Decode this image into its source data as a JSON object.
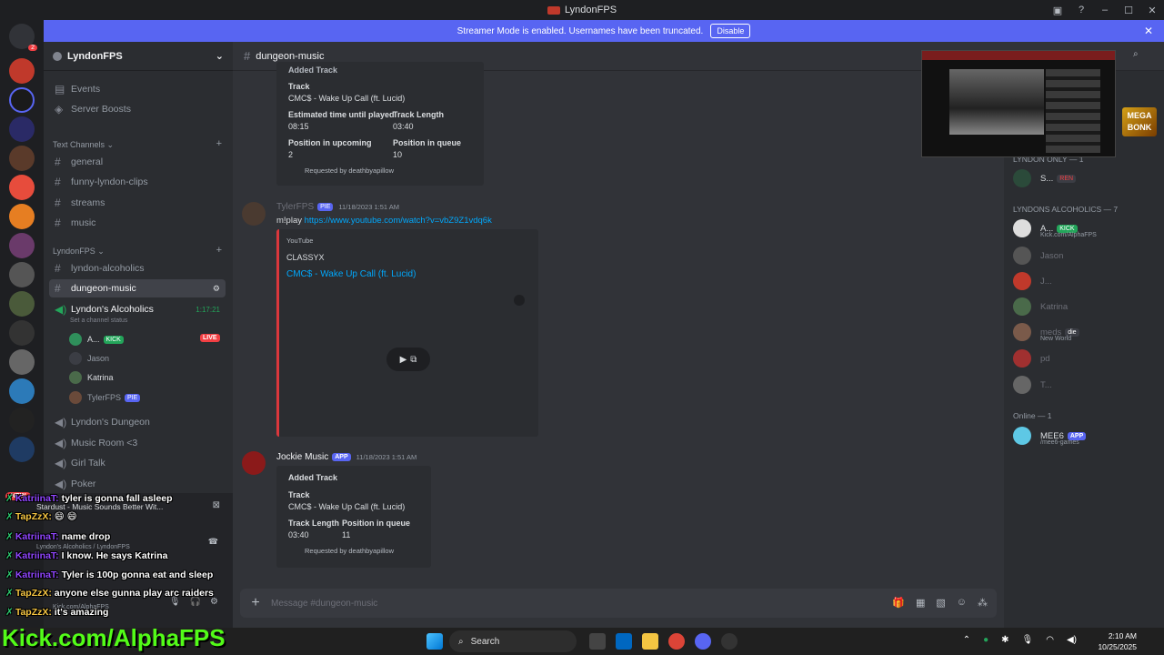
{
  "window": {
    "title": "LyndonFPS"
  },
  "banner": {
    "text": "Streamer Mode is enabled. Usernames have been truncated.",
    "disable_label": "Disable"
  },
  "server": {
    "name": "LyndonFPS"
  },
  "sidebar": {
    "top_items": [
      {
        "label": "Events"
      },
      {
        "label": "Server Boosts"
      }
    ],
    "text_category": "Text Channels",
    "text_channels": [
      "general",
      "funny-lyndon-clips",
      "streams",
      "music"
    ],
    "lyndon_category": "LyndonFPS",
    "lyndon_channels": [
      "lyndon-alcoholics",
      "dungeon-music"
    ],
    "voice_active": {
      "name": "Lyndon's Alcoholics",
      "timer": "1:17:21",
      "status_hint": "Set a channel status"
    },
    "voice_users": [
      {
        "name": "A...",
        "tag": "KICK",
        "live": "LIVE"
      },
      {
        "name": "Jason"
      },
      {
        "name": "Katrina"
      },
      {
        "name": "TylerFPS",
        "tag": "PIE"
      }
    ],
    "voice_channels": [
      "Lyndon's Dungeon",
      "Music Room <3",
      "Girl Talk",
      "Poker"
    ],
    "now_playing": "Stardust - Music Sounds Better Wit...",
    "voice_connected": "Lyndon's Alcoholics / LyndonFPS",
    "user_name": "Kick.com/AlphaFPS"
  },
  "chat": {
    "channel": "dungeon-music",
    "embed1": {
      "header": "Added Track",
      "track_label": "Track",
      "track": "CMC$ - Wake Up Call (ft. Lucid)",
      "eta_label": "Estimated time until played",
      "eta": "08:15",
      "length_label": "Track Length",
      "length": "03:40",
      "pos_up_label": "Position in upcoming",
      "pos_up": "2",
      "pos_q_label": "Position in queue",
      "pos_q": "10",
      "requested": "Requested by deathbyapillow"
    },
    "msg2": {
      "author": "TylerFPS",
      "tag": "PIE",
      "time": "11/18/2023 1:51 AM",
      "text_prefix": "m!play ",
      "url": "https://www.youtube.com/watch?v=vbZ9Z1vdq6k",
      "embed_provider": "YouTube",
      "embed_author": "CLASSYX",
      "embed_title": "CMC$ - Wake Up Call (ft. Lucid)"
    },
    "msg3": {
      "author": "Jockie Music",
      "badge": "APP",
      "time": "11/18/2023 1:51 AM",
      "header": "Added Track",
      "track_label": "Track",
      "track": "CMC$ - Wake Up Call (ft. Lucid)",
      "length_label": "Track Length",
      "length": "03:40",
      "pos_q_label": "Position in queue",
      "pos_q": "11",
      "requested": "Requested by deathbyapillow"
    },
    "composer_placeholder": "Message #dungeon-music"
  },
  "members": {
    "cat1": "LYNDON ONLY — 1",
    "cat1_user": {
      "name": "S...",
      "tag": "REN"
    },
    "cat2": "LYNDONS ALCOHOLICS — 7",
    "cat2_users": [
      {
        "name": "A...",
        "tag": "KICK",
        "sub": "Kick.com/AlphaFPS"
      },
      {
        "name": "Jason"
      },
      {
        "name": "J..."
      },
      {
        "name": "Katrina"
      },
      {
        "name": "meds",
        "tag": "die",
        "sub": "New World"
      },
      {
        "name": "pd"
      },
      {
        "name": "T..."
      }
    ],
    "cat3": "Online — 1",
    "cat3_user": {
      "name": "MEE6",
      "badge": "APP",
      "sub": "/mee6-games"
    }
  },
  "overlay": {
    "megabonk": "MEGA BONK",
    "twitch_chat": [
      {
        "user": "KatriinaT:",
        "msg": "tyler is gonna fall asleep"
      },
      {
        "user": "TapZzX:",
        "msg": "😄 😄"
      },
      {
        "user": "KatriinaT:",
        "msg": "name drop"
      },
      {
        "user": "KatriinaT:",
        "msg": "I know. He says Katrina"
      },
      {
        "user": "KatriinaT:",
        "msg": "Tyler is 100p gonna eat and sleep"
      },
      {
        "user": "TapZzX:",
        "msg": "anyone else gunna play arc raiders"
      },
      {
        "user": "TapZzX:",
        "msg": "it's amazing"
      }
    ],
    "kick_url": "Kick.com/AlphaFPS"
  },
  "taskbar": {
    "search": "Search",
    "time": "2:10 AM",
    "date": "10/25/2025"
  },
  "colors": {
    "blurple": "#5865f2",
    "red_accent": "#da373c",
    "link": "#00a8fc",
    "kick_green": "#53fc18"
  }
}
